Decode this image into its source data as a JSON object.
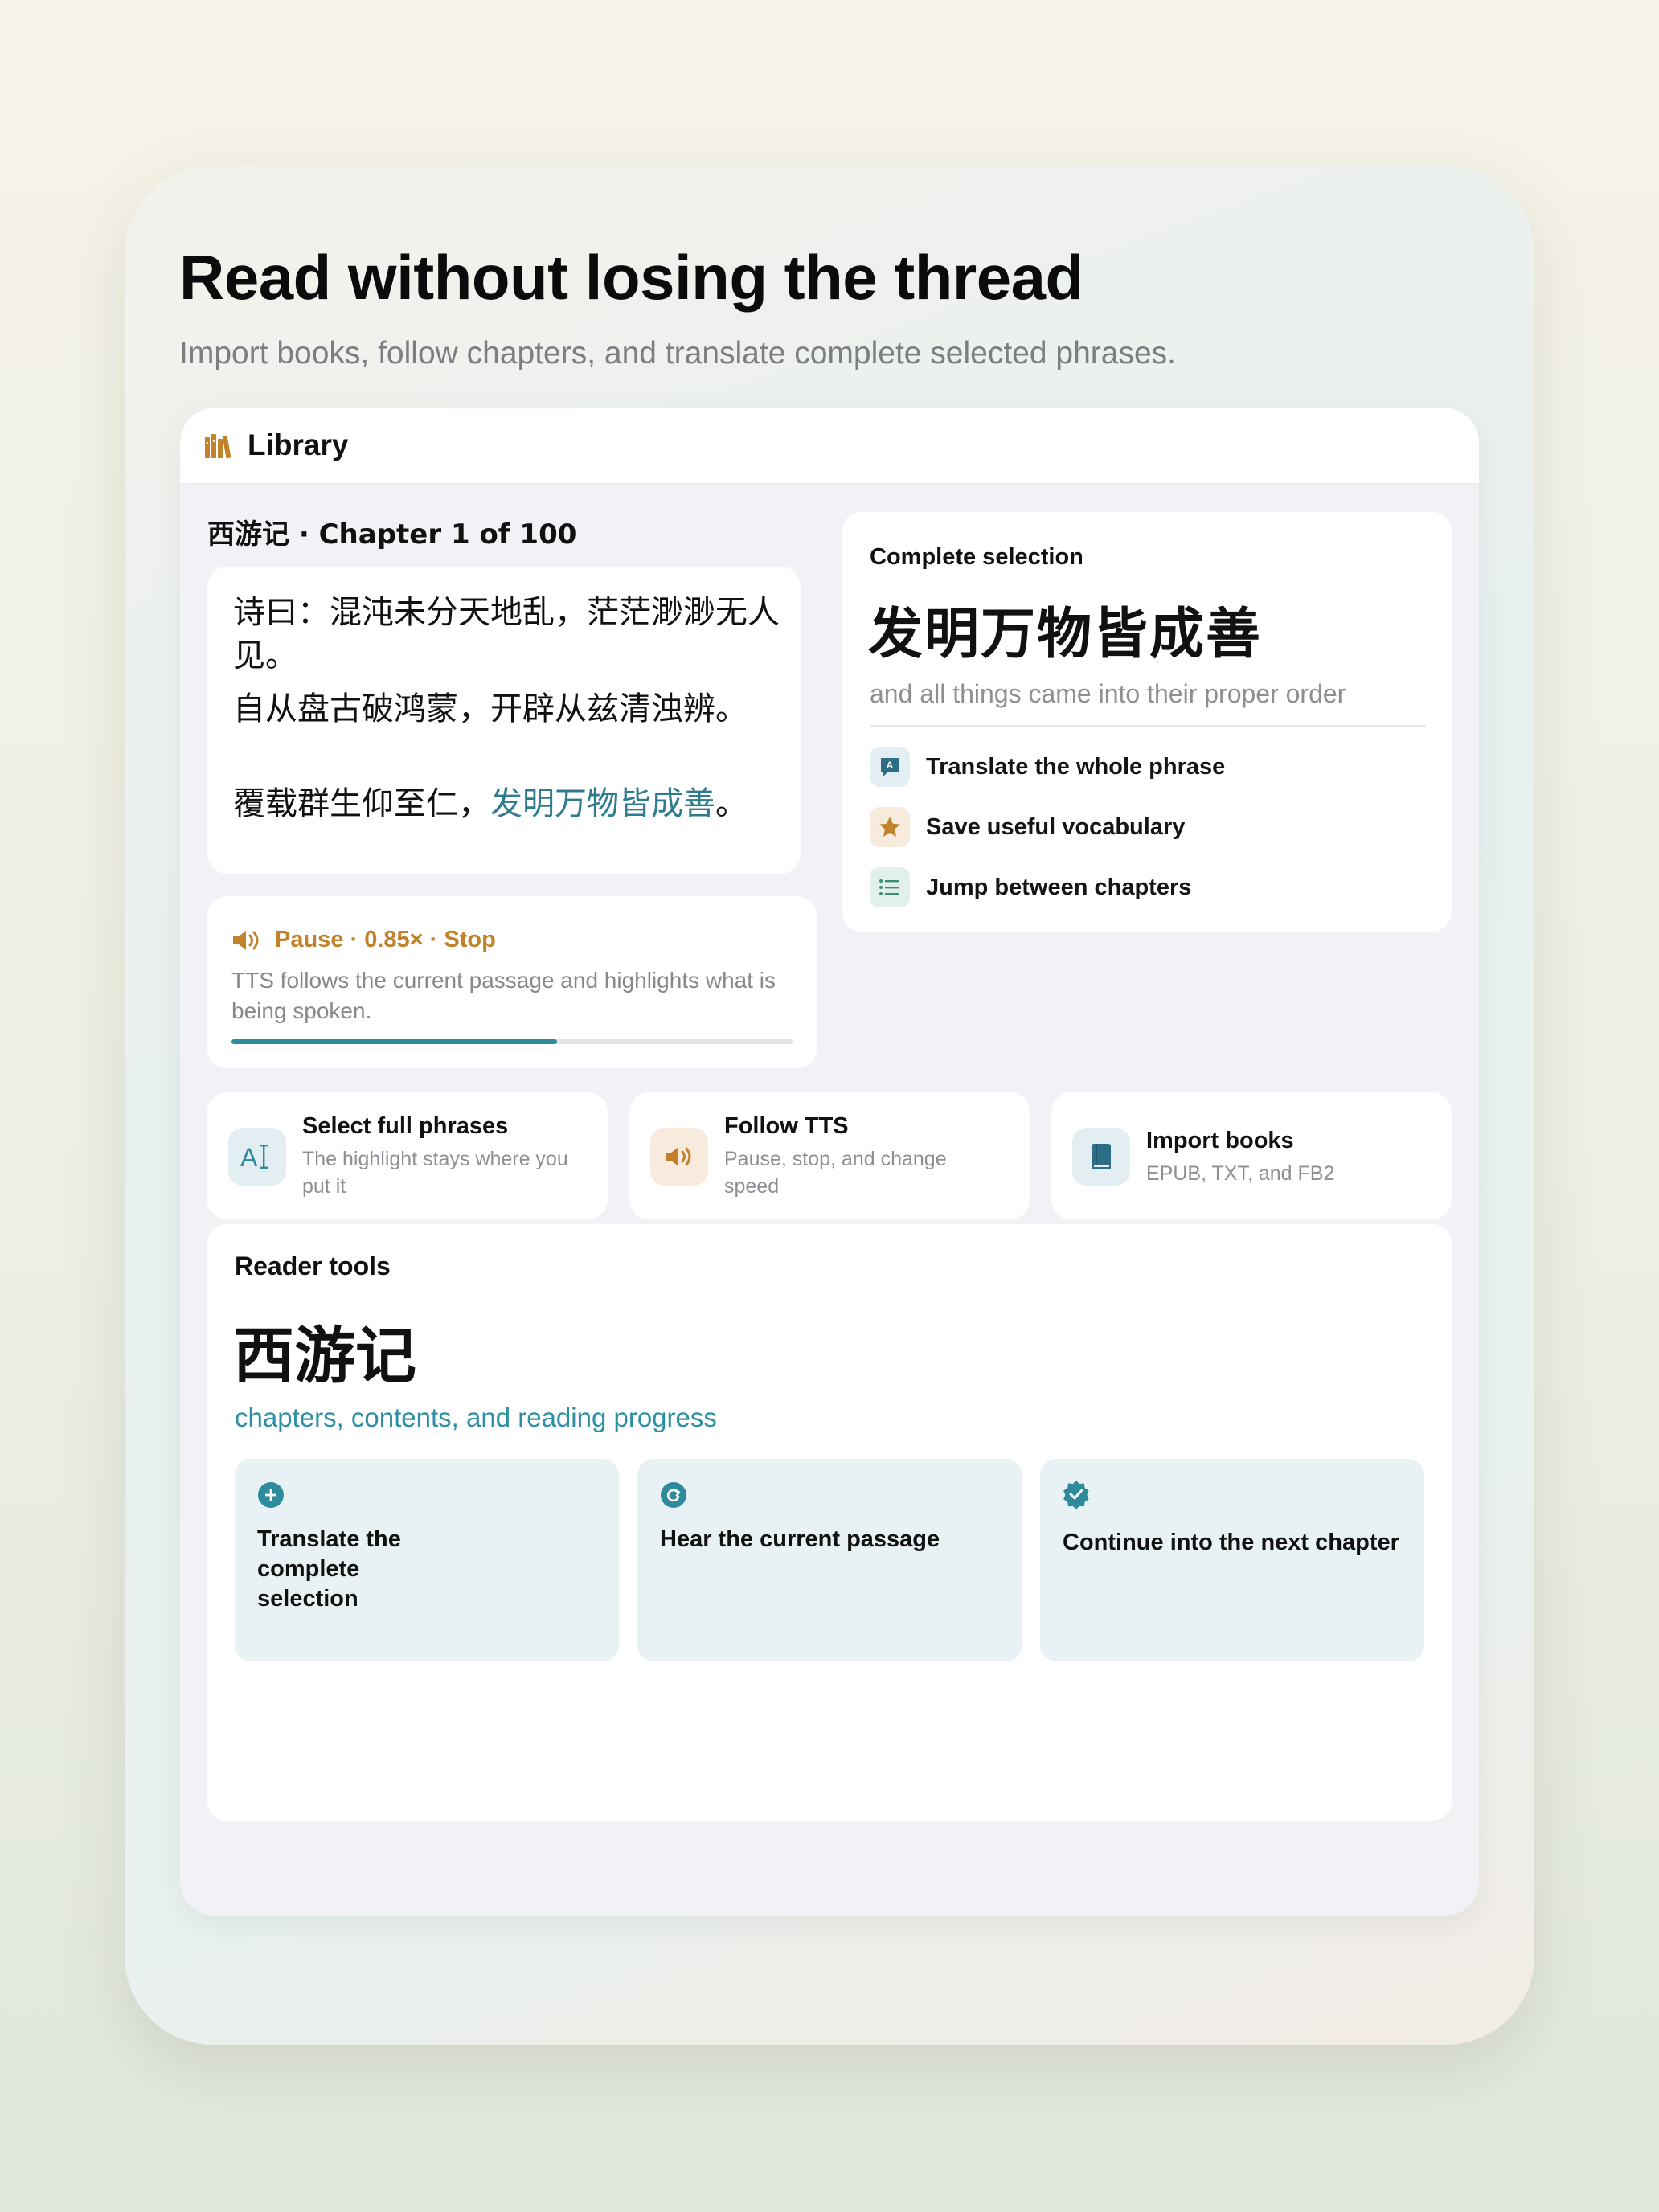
{
  "headline": "Read without losing the thread",
  "subheadline": "Import books, follow chapters, and translate complete selected phrases.",
  "navbar": {
    "title": "Library",
    "icon": "books-icon"
  },
  "reader": {
    "chapter_label": "西游记 · Chapter 1 of 100",
    "lines": [
      "诗曰：混沌未分天地乱，茫茫渺渺无人见。",
      "自从盘古破鸿蒙，开辟从兹清浊辨。"
    ],
    "line3_prefix": "覆载群生仰至仁，",
    "line3_highlight": "发明万物皆成善",
    "line3_suffix": "。",
    "highlight_color": "#2d7b8c"
  },
  "tts": {
    "controls": "Pause · 0.85× · Stop",
    "description": "TTS follows the current passage and highlights what is being spoken.",
    "progress": 0.58,
    "accent": "#c0822a"
  },
  "selection": {
    "label": "Complete selection",
    "phrase": "发明万物皆成善",
    "translation": "and all things came into their proper order",
    "features": [
      {
        "icon": "translate-icon",
        "label": "Translate the whole phrase"
      },
      {
        "icon": "star-icon",
        "label": "Save useful vocabulary"
      },
      {
        "icon": "list-icon",
        "label": "Jump between chapters"
      }
    ]
  },
  "feature_cards": [
    {
      "icon": "text-cursor-icon",
      "title": "Select full phrases",
      "desc": "The highlight stays where you put it"
    },
    {
      "icon": "speaker-icon",
      "title": "Follow TTS",
      "desc": "Pause, stop, and change speed"
    },
    {
      "icon": "book-icon",
      "title": "Import books",
      "desc": "EPUB, TXT, and FB2"
    }
  ],
  "tools": {
    "label": "Reader tools",
    "title": "西游记",
    "subtitle": "chapters, contents, and reading progress",
    "tiles": [
      {
        "icon": "plus-circle-icon",
        "label": "Translate the complete selection"
      },
      {
        "icon": "refresh-circle-icon",
        "label": "Hear the current passage"
      },
      {
        "icon": "verified-badge-icon",
        "label": "Continue into the next chapter"
      }
    ]
  },
  "colors": {
    "teal": "#2f8a9c",
    "gold": "#c0822a",
    "panel": "#f1f1f6"
  }
}
